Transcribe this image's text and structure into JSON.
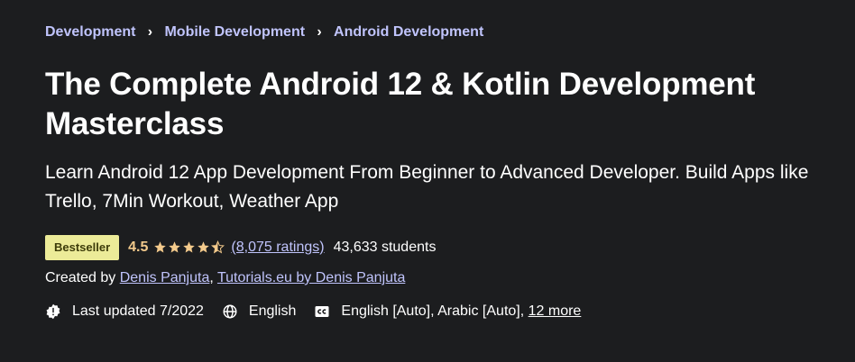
{
  "breadcrumb": {
    "items": [
      "Development",
      "Mobile Development",
      "Android Development"
    ],
    "separator": "›"
  },
  "course": {
    "title": "The Complete Android 12 & Kotlin Development Masterclass",
    "subtitle": "Learn Android 12 App Development From Beginner to Advanced Developer. Build Apps like Trello, 7Min Workout, Weather App",
    "badge": "Bestseller",
    "rating": "4.5",
    "rating_value": 4.5,
    "ratings_count": "(8,075 ratings)",
    "students": "43,633 students",
    "created_by_label": "Created by",
    "instructors": [
      "Denis Panjuta",
      "Tutorials.eu by Denis Panjuta"
    ],
    "instructor_separator": ",",
    "last_updated": "Last updated 7/2022",
    "language": "English",
    "captions": "English [Auto], Arabic [Auto],",
    "more_captions": "12 more"
  },
  "icons": {
    "star": "star-icon",
    "updated": "alert-badge-icon",
    "language": "globe-icon",
    "captions": "closed-captions-icon"
  },
  "colors": {
    "background": "#1c1d1f",
    "link": "#c0c4fc",
    "rating": "#f3ca8c",
    "badge_bg": "#eceb98",
    "badge_text": "#3d3c0a"
  }
}
